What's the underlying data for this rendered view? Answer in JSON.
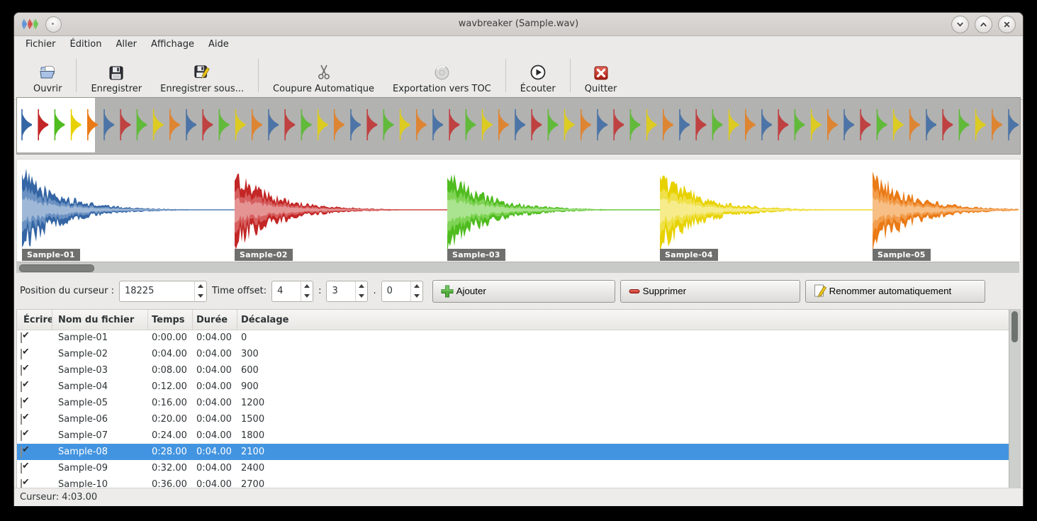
{
  "window": {
    "title": "wavbreaker (Sample.wav)"
  },
  "menu": {
    "items": [
      "Fichier",
      "Édition",
      "Aller",
      "Affichage",
      "Aide"
    ]
  },
  "toolbar": {
    "items": [
      {
        "label": "Ouvrir",
        "icon": "open-folder-icon"
      },
      {
        "label": "Enregistrer",
        "icon": "save-icon"
      },
      {
        "label": "Enregistrer sous...",
        "icon": "save-as-icon"
      },
      {
        "label": "Coupure Automatique",
        "icon": "scissors-icon"
      },
      {
        "label": "Exportation vers TOC",
        "icon": "cd-icon"
      },
      {
        "label": "Écouter",
        "icon": "play-icon"
      },
      {
        "label": "Quitter",
        "icon": "quit-icon"
      }
    ]
  },
  "waveform": {
    "overview_spike_count": 61,
    "segments": [
      {
        "label": "Sample-01",
        "color": {
          "dark": "#3465a4",
          "mid": "#6b92c2",
          "light": "#9fb8d8"
        }
      },
      {
        "label": "Sample-02",
        "color": {
          "dark": "#c32626",
          "mid": "#d65f5f",
          "light": "#e59494"
        }
      },
      {
        "label": "Sample-03",
        "color": {
          "dark": "#4fbc1f",
          "mid": "#7fd355",
          "light": "#abe490"
        }
      },
      {
        "label": "Sample-04",
        "color": {
          "dark": "#e7d200",
          "mid": "#f0e14a",
          "light": "#f6ec8c"
        }
      },
      {
        "label": "Sample-05",
        "color": {
          "dark": "#ea7a15",
          "mid": "#f29e4e",
          "light": "#f7bf85"
        }
      }
    ]
  },
  "controls": {
    "cursor_position_label": "Position du curseur :",
    "cursor_position_value": "18225",
    "time_offset_label": "Time offset:",
    "time_offset_minutes": "4",
    "time_offset_sep1": ":",
    "time_offset_seconds": "3",
    "time_offset_sep2": ".",
    "time_offset_subseconds": "0",
    "add_label": "Ajouter",
    "delete_label": "Supprimer",
    "rename_label": "Renommer automatiquement"
  },
  "table": {
    "columns": [
      "Écrire",
      "Nom du fichier",
      "Temps",
      "Durée",
      "Décalage"
    ],
    "rows": [
      {
        "write": true,
        "name": "Sample-01",
        "time": "0:00.00",
        "duration": "0:04.00",
        "offset": "0",
        "selected": false
      },
      {
        "write": true,
        "name": "Sample-02",
        "time": "0:04.00",
        "duration": "0:04.00",
        "offset": "300",
        "selected": false
      },
      {
        "write": true,
        "name": "Sample-03",
        "time": "0:08.00",
        "duration": "0:04.00",
        "offset": "600",
        "selected": false
      },
      {
        "write": true,
        "name": "Sample-04",
        "time": "0:12.00",
        "duration": "0:04.00",
        "offset": "900",
        "selected": false
      },
      {
        "write": true,
        "name": "Sample-05",
        "time": "0:16.00",
        "duration": "0:04.00",
        "offset": "1200",
        "selected": false
      },
      {
        "write": true,
        "name": "Sample-06",
        "time": "0:20.00",
        "duration": "0:04.00",
        "offset": "1500",
        "selected": false
      },
      {
        "write": true,
        "name": "Sample-07",
        "time": "0:24.00",
        "duration": "0:04.00",
        "offset": "1800",
        "selected": false
      },
      {
        "write": true,
        "name": "Sample-08",
        "time": "0:28.00",
        "duration": "0:04.00",
        "offset": "2100",
        "selected": true
      },
      {
        "write": true,
        "name": "Sample-09",
        "time": "0:32.00",
        "duration": "0:04.00",
        "offset": "2400",
        "selected": false
      },
      {
        "write": true,
        "name": "Sample-10",
        "time": "0:36.00",
        "duration": "0:04.00",
        "offset": "2700",
        "selected": false
      }
    ]
  },
  "statusbar": {
    "text": "Curseur: 4:03.00"
  },
  "icons": {
    "check": "✔"
  },
  "colors": {
    "selection": "#4394e0",
    "overview_background": "#b2b2b0",
    "overview_viewport": "#ffffff"
  }
}
